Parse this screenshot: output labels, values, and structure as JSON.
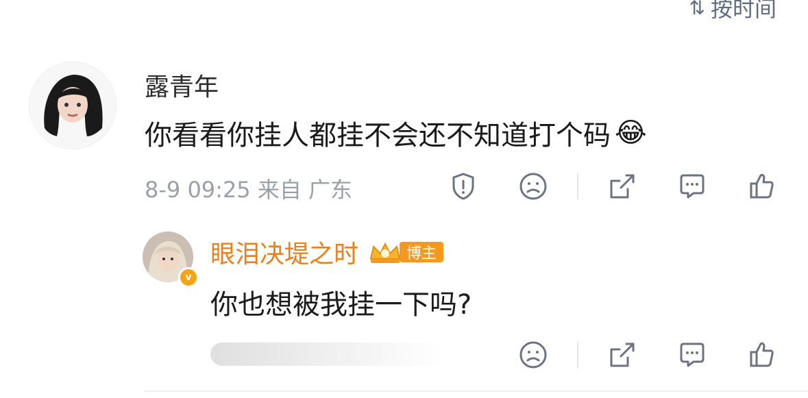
{
  "header": {
    "sort_label": "按时间",
    "sort_icon": "sort-icon"
  },
  "comment": {
    "user_name": "露青年",
    "text": "你看看你挂人都挂不会还不知道打个码",
    "emoji": "😂",
    "meta": "8-9 09:25 来自 广东",
    "actions": [
      "report-icon",
      "dislike-icon",
      "share-icon",
      "comment-icon",
      "like-icon"
    ]
  },
  "reply": {
    "user_name": "眼泪决堤之时",
    "badge_label": "博主",
    "text": "你也想被我挂一下吗?",
    "verified_glyph": "v",
    "actions": [
      "dislike-icon",
      "share-icon",
      "comment-icon",
      "like-icon"
    ]
  },
  "colors": {
    "accent": "#f07e16",
    "muted": "#9aa0a6",
    "icon": "#6b7280"
  }
}
